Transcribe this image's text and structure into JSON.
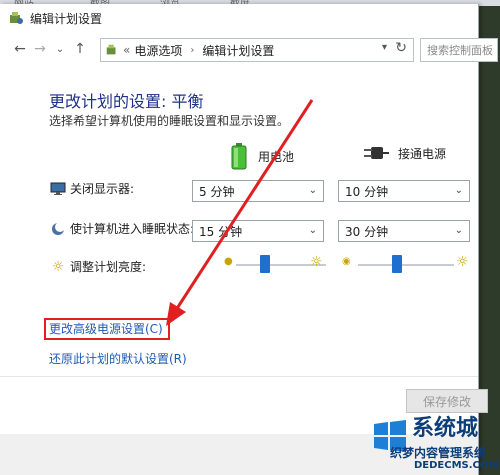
{
  "top_strip": {
    "items": [
      "网站",
      "截图",
      "浏览",
      "截屏"
    ]
  },
  "window": {
    "title": "编辑计划设置"
  },
  "nav": {
    "back": "←",
    "forward": "→",
    "history": "⌄",
    "up": "↑",
    "breadcrumb_prefix": "«",
    "breadcrumb": [
      "电源选项",
      "编辑计划设置"
    ],
    "breadcrumb_sep": "›",
    "refresh": "↻",
    "search_placeholder": "搜索控制面板"
  },
  "page": {
    "heading": "更改计划的设置: 平衡",
    "subheading": "选择希望计算机使用的睡眠设置和显示设置。"
  },
  "columns": {
    "battery": "用电池",
    "plugged": "接通电源"
  },
  "rows": {
    "display_off": {
      "label": "关闭显示器:",
      "battery": "5 分钟",
      "plugged": "10 分钟"
    },
    "sleep": {
      "label": "使计算机进入睡眠状态:",
      "battery": "15 分钟",
      "plugged": "30 分钟"
    },
    "brightness": {
      "label": "调整计划亮度:",
      "battery_level": 0.3,
      "plugged_level": 0.4
    }
  },
  "links": {
    "advanced": "更改高级电源设置(C)",
    "restore": "还原此计划的默认设置(R)"
  },
  "buttons": {
    "save": "保存修改"
  },
  "watermark": {
    "line1": "系统城",
    "line2": "织梦内容管理系统",
    "line3": "DEDECMS.COM"
  },
  "colors": {
    "accent": "#1e3287",
    "link": "#1e5bb5",
    "annotation": "#e02020",
    "slider_thumb": "#1f6fd0"
  }
}
